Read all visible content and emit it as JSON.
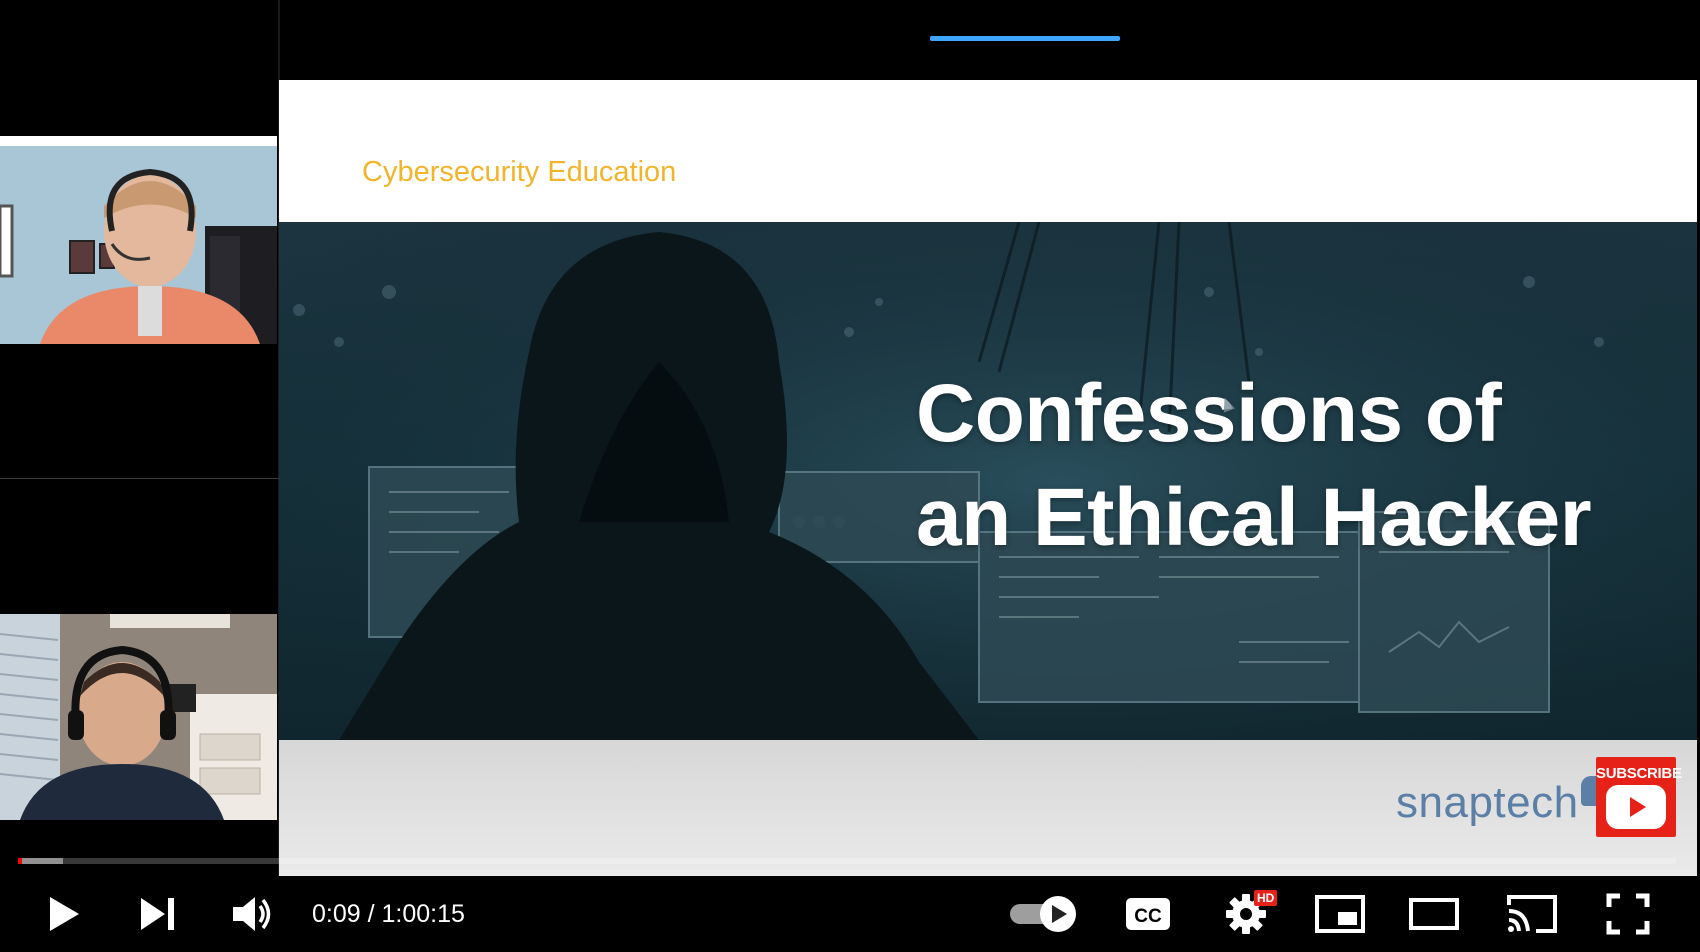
{
  "slide": {
    "kicker": "Cybersecurity Education",
    "title": "Confessions of\nan Ethical Hacker",
    "logo_text": "snaptech"
  },
  "subscribe": {
    "label": "SUBSCRIBE"
  },
  "player": {
    "current_time": "0:09",
    "separator": " / ",
    "duration": "1:00:15",
    "time_text": "0:09 / 1:00:15",
    "progress_played_fraction": 0.0025,
    "progress_buffered_fraction": 0.027,
    "settings_badge": "HD",
    "autoplay_on": true
  },
  "colors": {
    "accent_red": "#ff0000",
    "kicker_gold": "#f2b42a",
    "logo_blue": "#5b7fa6",
    "chapter_marker": "#3ea6ff"
  },
  "icons": {
    "play": "play-icon",
    "next": "next-icon",
    "volume": "volume-icon",
    "autoplay": "autoplay-toggle-icon",
    "captions": "cc-icon",
    "settings": "gear-icon",
    "miniplayer": "miniplayer-icon",
    "theater": "theater-mode-icon",
    "cast": "cast-icon",
    "fullscreen": "fullscreen-icon"
  }
}
